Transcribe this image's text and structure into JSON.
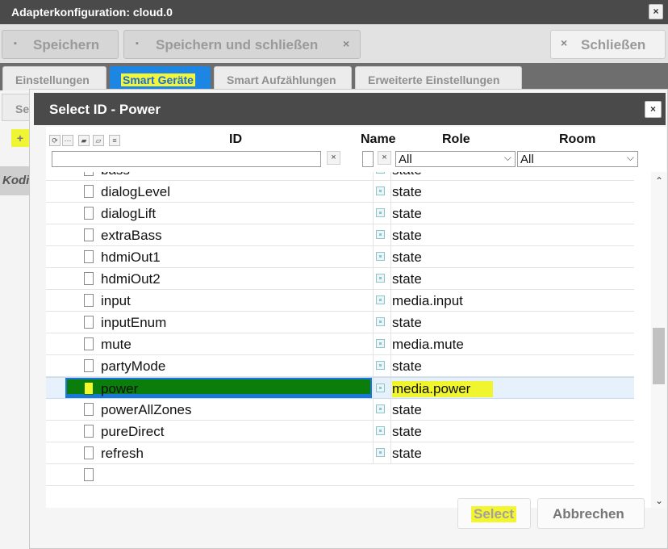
{
  "window": {
    "title": "Adapterkonfiguration: cloud.0",
    "close_icon": "×"
  },
  "toolbar": {
    "save_label": "Speichern",
    "save_close_label": "Speichern und schließen",
    "close_label": "Schließen",
    "save_icon": "▪",
    "x_icon": "×"
  },
  "tabs": [
    {
      "label": "Einstellungen"
    },
    {
      "label": "Smart Geräte",
      "active": true
    },
    {
      "label": "Smart Aufzählungen"
    },
    {
      "label": "Erweiterte Einstellungen"
    }
  ],
  "background": {
    "tab2_label": "Se",
    "plus_label": "+",
    "row_label": "Kodi"
  },
  "dialog": {
    "title": "Select ID - Power",
    "close_icon": "×",
    "headers": {
      "id": "ID",
      "name": "Name",
      "role": "Role",
      "room": "Room"
    },
    "filters": {
      "id_value": "",
      "name_value": "",
      "clear_icon": "×",
      "role_selected": "All",
      "room_selected": "All",
      "caret": "⌵"
    },
    "rows": [
      {
        "id": "bass",
        "role": "state"
      },
      {
        "id": "dialogLevel",
        "role": "state"
      },
      {
        "id": "dialogLift",
        "role": "state"
      },
      {
        "id": "extraBass",
        "role": "state"
      },
      {
        "id": "hdmiOut1",
        "role": "state"
      },
      {
        "id": "hdmiOut2",
        "role": "state"
      },
      {
        "id": "input",
        "role": "media.input"
      },
      {
        "id": "inputEnum",
        "role": "state"
      },
      {
        "id": "mute",
        "role": "media.mute"
      },
      {
        "id": "partyMode",
        "role": "state"
      },
      {
        "id": "power",
        "role": "media.power",
        "selected": true
      },
      {
        "id": "powerAllZones",
        "role": "state"
      },
      {
        "id": "pureDirect",
        "role": "state"
      },
      {
        "id": "refresh",
        "role": "state"
      },
      {
        "id": "",
        "role": ""
      }
    ],
    "scroll_up": "⌃",
    "scroll_down": "⌄",
    "select_label": "Select",
    "cancel_label": "Abbrechen"
  },
  "colors": {
    "accent": "#1d86e2",
    "highlight": "#f2f53a",
    "title_bar": "#4a4a4a"
  }
}
